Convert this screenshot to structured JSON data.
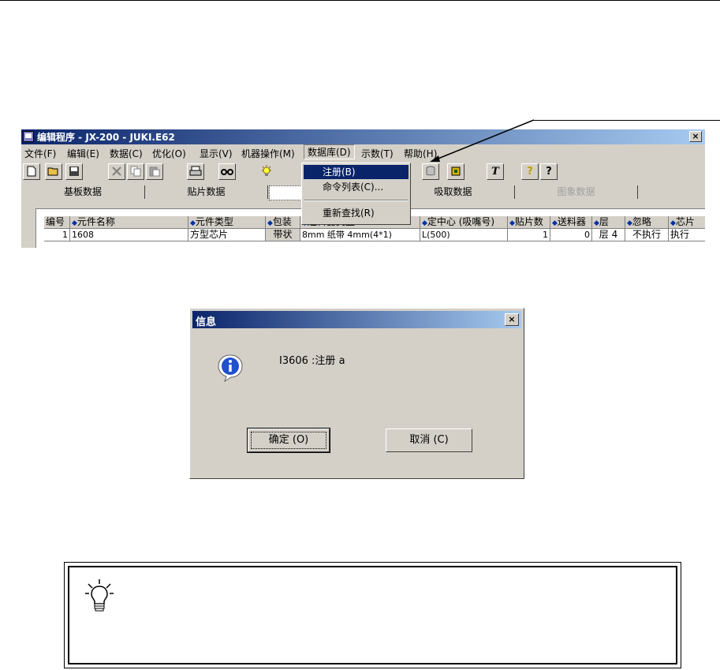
{
  "app_window": {
    "title": "编辑程序 - JX-200 - JUKI.E62",
    "close_label": "×",
    "menu": [
      {
        "label": "文件(F)"
      },
      {
        "label": "编辑(E)"
      },
      {
        "label": "数据(C)"
      },
      {
        "label": "优化(O)"
      },
      {
        "label": "显示(V)"
      },
      {
        "label": "机器操作(M)"
      },
      {
        "label": "数据库(D)"
      },
      {
        "label": "示数(T)"
      },
      {
        "label": "帮助(H)"
      }
    ],
    "toolbar_icons": [
      "new-icon",
      "open-icon",
      "save-icon",
      "delete-icon",
      "copy-icon",
      "paste-icon",
      "print-icon",
      "find-icon",
      "bulb-icon",
      "library-icon",
      "chip-icon",
      "text-icon",
      "help-icon",
      "context-help-icon"
    ],
    "toolbar_glyphs": {
      "text": "T",
      "help": "?",
      "context_help": "?"
    },
    "tabs": [
      {
        "label": "基板数据"
      },
      {
        "label": "贴片数据"
      },
      {
        "label": ""
      },
      {
        "label": "吸取数据"
      },
      {
        "label": "图象数据"
      }
    ],
    "grid": {
      "columns": [
        "编号",
        "元件名称",
        "元件类型",
        "包装",
        "送料器类型",
        "定中心 (吸嘴号)",
        "贴片数",
        "送料器",
        "层",
        "忽略",
        "芯片"
      ],
      "row": [
        "1",
        "1608",
        "方型芯片",
        "带状",
        "8mm 纸带  4mm(4*1)",
        "L(500)",
        "1",
        "0",
        "层 4",
        "不执行",
        "执行"
      ]
    },
    "dropdown": [
      {
        "label": "注册(B)"
      },
      {
        "label": "命令列表(C)..."
      },
      {
        "label": "重新查找(R)"
      }
    ]
  },
  "dialog": {
    "title": "信息",
    "close_label": "×",
    "message": "I3606 :注册 a",
    "ok_label": "确定 (O)",
    "cancel_label": "取消 (C)"
  },
  "note": {
    "icon": "lightbulb-icon"
  },
  "colors": {
    "titlebar_start": "#0a246a",
    "titlebar_end": "#a6caf0",
    "window_face": "#d4d0c8",
    "highlight": "#0a246a"
  }
}
